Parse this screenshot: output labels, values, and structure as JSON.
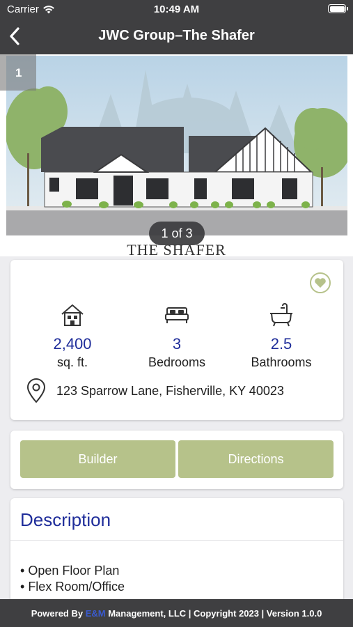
{
  "status_bar": {
    "carrier": "Carrier",
    "time": "10:49 AM"
  },
  "nav": {
    "title": "JWC Group–The Shafer"
  },
  "gallery": {
    "index": "1",
    "counter": "1 of 3",
    "caption": "THE SHAFER"
  },
  "stats": {
    "sqft": {
      "value": "2,400",
      "label": "sq. ft."
    },
    "bedrooms": {
      "value": "3",
      "label": "Bedrooms"
    },
    "bathrooms": {
      "value": "2.5",
      "label": "Bathrooms"
    }
  },
  "address": "123 Sparrow Lane, Fisherville, KY 40023",
  "actions": {
    "builder": "Builder",
    "directions": "Directions"
  },
  "description": {
    "heading": "Description",
    "items": [
      "Open Floor Plan",
      "Flex Room/Office"
    ]
  },
  "footer": {
    "powered_by": "Powered By ",
    "brand": "E&M",
    "rest": " Management, LLC | Copyright 2023 | Version 1.0.0"
  },
  "colors": {
    "accent_green": "#b6c28a",
    "accent_blue": "#1f2d9a",
    "bar": "#3f3f41"
  },
  "icons": [
    "wifi-icon",
    "battery-icon",
    "back-chevron-icon",
    "heart-icon",
    "house-icon",
    "bed-icon",
    "bathtub-icon",
    "location-pin-icon"
  ]
}
